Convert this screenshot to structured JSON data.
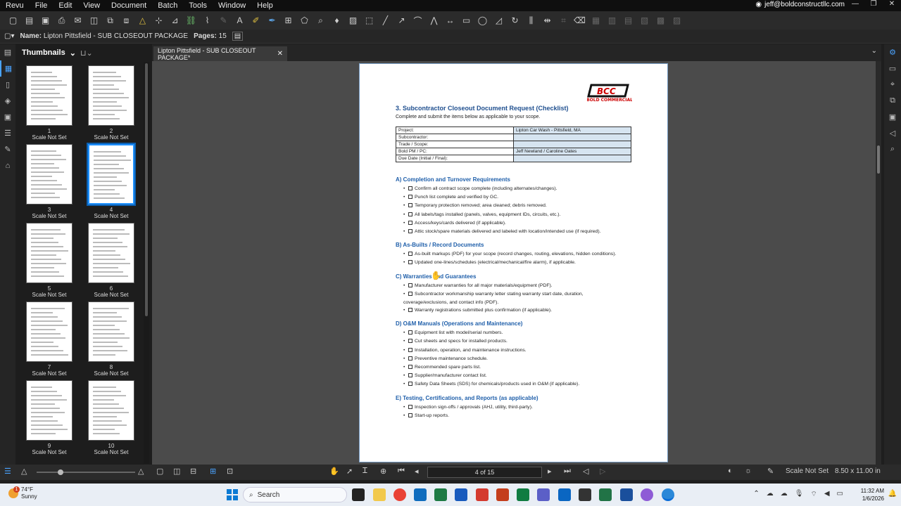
{
  "menu": {
    "items": [
      "Revu",
      "File",
      "Edit",
      "View",
      "Document",
      "Batch",
      "Tools",
      "Window",
      "Help"
    ],
    "account": "jeff@boldconstructllc.com"
  },
  "properties": {
    "name_label": "Name:",
    "name_value": "Lipton Pittsfield - SUB CLOSEOUT PACKAGE",
    "pages_label": "Pages:",
    "pages_value": "15"
  },
  "thumbnails": {
    "title": "Thumbnails",
    "items": [
      {
        "num": "1",
        "caption": "Scale Not Set"
      },
      {
        "num": "2",
        "caption": "Scale Not Set"
      },
      {
        "num": "3",
        "caption": "Scale Not Set"
      },
      {
        "num": "4",
        "caption": "Scale Not Set",
        "selected": true
      },
      {
        "num": "5",
        "caption": "Scale Not Set"
      },
      {
        "num": "6",
        "caption": "Scale Not Set"
      },
      {
        "num": "7",
        "caption": "Scale Not Set"
      },
      {
        "num": "8",
        "caption": "Scale Not Set"
      },
      {
        "num": "9",
        "caption": "Scale Not Set"
      },
      {
        "num": "10",
        "caption": "Scale Not Set"
      }
    ]
  },
  "tab": {
    "label": "Lipton Pittsfield - SUB CLOSEOUT PACKAGE*"
  },
  "document": {
    "logo_text": "BOLD COMMERCIAL",
    "title": "3. Subcontractor Closeout Document Request (Checklist)",
    "subtitle": "Complete and submit the items below as applicable to your scope.",
    "info": [
      {
        "label": "Project:",
        "value": "Lipton Car Wash - Pittsfield, MA"
      },
      {
        "label": "Subcontractor:",
        "value": ""
      },
      {
        "label": "Trade / Scope:",
        "value": ""
      },
      {
        "label": "Bold PM / PC:",
        "value": "Jeff Newland / Caroline Oates"
      },
      {
        "label": "Due Date (Initial / Final):",
        "value": ""
      }
    ],
    "sections": [
      {
        "title": "A) Completion and Turnover Requirements",
        "items": [
          "Confirm all contract scope complete (including alternates/changes).",
          "Punch list complete and verified by GC.",
          "Temporary protection removed; area cleaned; debris removed.",
          "All labels/tags installed (panels, valves, equipment IDs, circuits, etc.).",
          "Access/keys/cards delivered (if applicable).",
          "Attic stock/spare materials delivered and labeled with location/intended use (if required)."
        ]
      },
      {
        "title": "B) As-Builts / Record Documents",
        "items": [
          "As-built markups (PDF) for your scope (record changes, routing, elevations, hidden conditions).",
          "Updated one-lines/schedules (electrical/mechanical/fire alarm), if applicable."
        ]
      },
      {
        "title": "C) Warranties and Guarantees",
        "items": [
          "Manufacturer warranties for all major materials/equipment (PDF).",
          "Subcontractor workmanship warranty letter stating warranty start date, duration,",
          "Warranty registrations submitted plus confirmation (if applicable)."
        ],
        "wrap": "coverage/exclusions, and contact info (PDF)."
      },
      {
        "title": "D) O&M Manuals (Operations and Maintenance)",
        "items": [
          "Equipment list with model/serial numbers.",
          "Cut sheets and specs for installed products.",
          "Installation, operation, and maintenance instructions.",
          "Preventive maintenance schedule.",
          "Recommended spare parts list.",
          "Supplier/manufacturer contact list.",
          "Safety Data Sheets (SDS) for chemicals/products used in O&M (if applicable)."
        ]
      },
      {
        "title": "E) Testing, Certifications, and Reports (as applicable)",
        "items": [
          "Inspection sign-offs / approvals (AHJ, utility, third-party).",
          "Start-up reports."
        ]
      }
    ]
  },
  "status": {
    "page_indicator": "4 of 15",
    "scale": "Scale Not Set",
    "page_size": "8.50 x 11.00 in"
  },
  "taskbar": {
    "temp": "74°F",
    "weather": "Sunny",
    "search_placeholder": "Search",
    "time": "11:32 AM",
    "date": "1/6/2026",
    "badge": "1"
  }
}
